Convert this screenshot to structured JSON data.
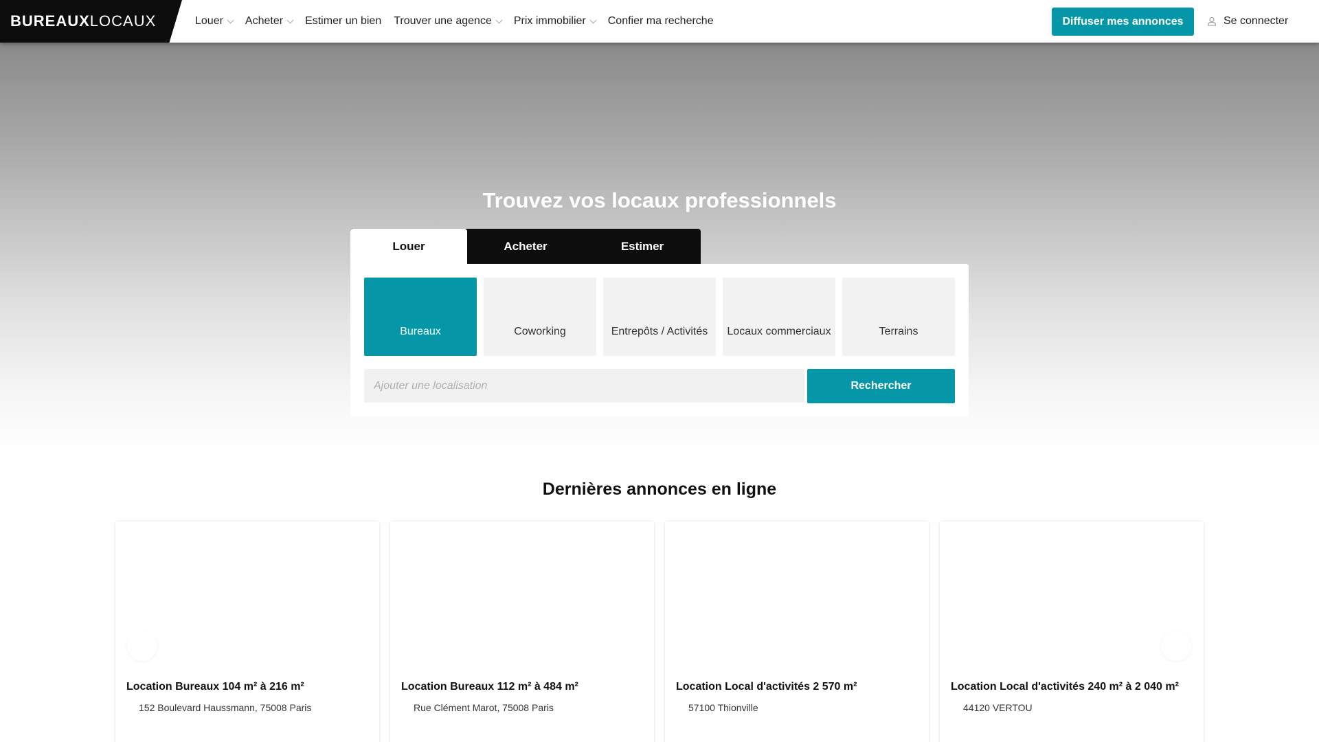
{
  "brand": {
    "part1": "BUREAUX",
    "part2": "LOCAUX"
  },
  "nav": {
    "items": [
      {
        "label": "Louer",
        "has_dropdown": true
      },
      {
        "label": "Acheter",
        "has_dropdown": true
      },
      {
        "label": "Estimer un bien",
        "has_dropdown": false
      },
      {
        "label": "Trouver une agence",
        "has_dropdown": true
      },
      {
        "label": "Prix immobilier",
        "has_dropdown": true
      },
      {
        "label": "Confier ma recherche",
        "has_dropdown": false
      }
    ],
    "cta_label": "Diffuser mes annonces",
    "login_label": "Se connecter",
    "login_icon": "user-icon"
  },
  "hero": {
    "title": "Trouvez vos locaux professionnels",
    "tabs": [
      "Louer",
      "Acheter",
      "Estimer"
    ],
    "active_tab": "Louer",
    "types": [
      "Bureaux",
      "Coworking",
      "Entrepôts / Activités",
      "Locaux commerciaux",
      "Terrains"
    ],
    "active_type": "Bureaux",
    "search_placeholder": "Ajouter une localisation",
    "search_button": "Rechercher"
  },
  "listings": {
    "title": "Dernières annonces en ligne",
    "cards": [
      {
        "title": "Location Bureaux 104 m² à 216 m²",
        "address": "152 Boulevard Haussmann, 75008 Paris"
      },
      {
        "title": "Location Bureaux 112 m² à 484 m²",
        "address": "Rue Clément Marot, 75008 Paris"
      },
      {
        "title": "Location Local d'activités 2 570 m²",
        "address": "57100 Thionville"
      },
      {
        "title": "Location Local d'activités 240 m² à 2 040 m²",
        "address": "44120 VERTOU"
      }
    ]
  },
  "colors": {
    "accent": "#0597a7",
    "dark": "#0d0d0d"
  }
}
